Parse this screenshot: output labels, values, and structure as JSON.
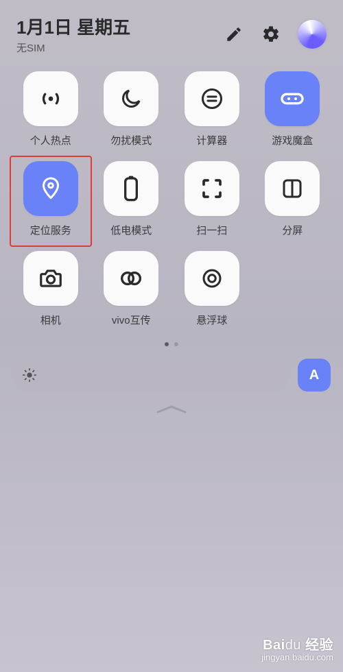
{
  "header": {
    "date": "1月1日 星期五",
    "sim": "无SIM"
  },
  "tiles": {
    "hotspot": "个人热点",
    "dnd": "勿扰模式",
    "calculator": "计算器",
    "gamebox": "游戏魔盒",
    "location": "定位服务",
    "lowbattery": "低电模式",
    "scan": "扫一扫",
    "splitscreen": "分屏",
    "camera": "相机",
    "vivoshare": "vivo互传",
    "floatball": "悬浮球"
  },
  "auto_label": "A",
  "watermark": {
    "line1_a": "Bai",
    "line1_b": "du",
    "line1_c": "经验",
    "line2": "jingyan.baidu.com"
  }
}
